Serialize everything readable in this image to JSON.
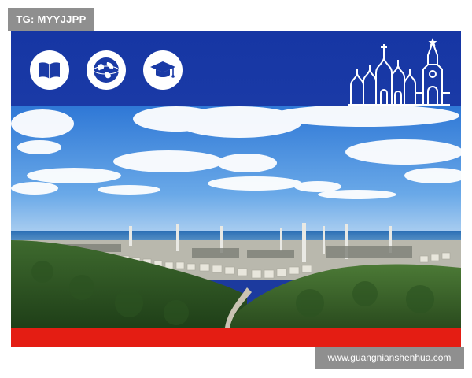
{
  "watermark_top": {
    "text": "TG: MYYJJPP"
  },
  "watermark_bottom": {
    "text": "www.guangnianshenhua.com"
  },
  "banner": {
    "icons": [
      "book-icon",
      "globe-icon",
      "graduation-cap-icon"
    ],
    "skyline": "kremlin-skyline-icon",
    "color": "#1a3aa6"
  },
  "photo": {
    "subject": "refinery-coastline-landscape"
  },
  "accent": {
    "red": "#e41d13",
    "blue": "#1a3aa6",
    "watermark": "#8f8f8f"
  }
}
